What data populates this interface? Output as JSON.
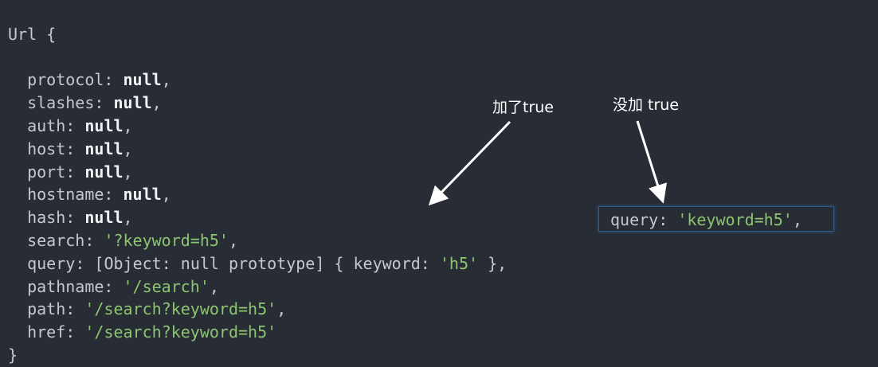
{
  "open": "Url {",
  "close": "}",
  "fields": [
    {
      "key": "protocol",
      "value": "null",
      "type": "null",
      "comma": ","
    },
    {
      "key": "slashes",
      "value": "null",
      "type": "null",
      "comma": ","
    },
    {
      "key": "auth",
      "value": "null",
      "type": "null",
      "comma": ","
    },
    {
      "key": "host",
      "value": "null",
      "type": "null",
      "comma": ","
    },
    {
      "key": "port",
      "value": "null",
      "type": "null",
      "comma": ","
    },
    {
      "key": "hostname",
      "value": "null",
      "type": "null",
      "comma": ","
    },
    {
      "key": "hash",
      "value": "null",
      "type": "null",
      "comma": ","
    },
    {
      "key": "search",
      "value": "'?keyword=h5'",
      "type": "string",
      "comma": ","
    },
    {
      "key": "query",
      "value": "[Object: null prototype] { keyword: 'h5' }",
      "type": "object",
      "comma": ","
    },
    {
      "key": "pathname",
      "value": "'/search'",
      "type": "string",
      "comma": ","
    },
    {
      "key": "path",
      "value": "'/search?keyword=h5'",
      "type": "string",
      "comma": ","
    },
    {
      "key": "href",
      "value": "'/search?keyword=h5'",
      "type": "string",
      "comma": ""
    }
  ],
  "query_object_prefix": "[Object: null prototype] { keyword: ",
  "query_object_value": "'h5'",
  "query_object_suffix": " }",
  "annotations": {
    "with_true": "加了true",
    "without_true": "没加 true"
  },
  "comparison": {
    "key": "query",
    "value": "'keyword=h5'",
    "comma": ","
  }
}
